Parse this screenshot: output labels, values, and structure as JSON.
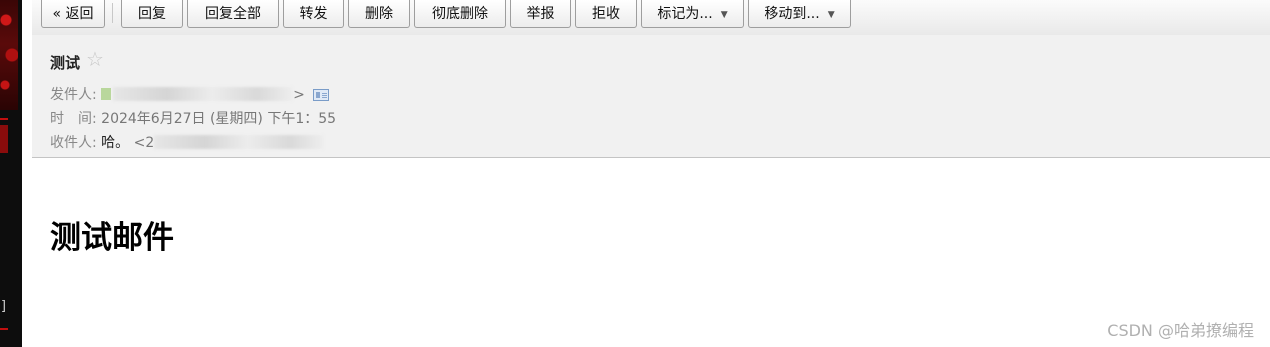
{
  "toolbar": {
    "back": "« 返回",
    "reply": "回复",
    "reply_all": "回复全部",
    "forward": "转发",
    "delete": "删除",
    "delete_permanently": "彻底删除",
    "report": "举报",
    "reject": "拒收",
    "mark_as": "标记为...",
    "move_to": "移动到..."
  },
  "email": {
    "subject": "测试",
    "star_icon": "star-outline-icon",
    "from_label": "发件人:",
    "from_suffix": ">",
    "time_label": "时　间:",
    "time_value": "2024年6月27日 (星期四) 下午1：55",
    "to_label": "收件人:",
    "to_name": "哈。",
    "to_prefix": "<2",
    "body": "测试邮件"
  },
  "watermark": "CSDN @哈弟撩编程"
}
